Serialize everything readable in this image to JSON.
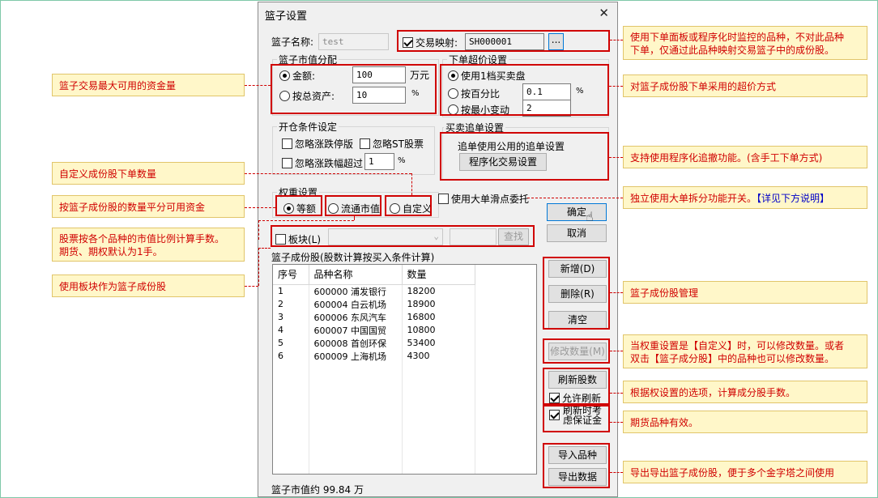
{
  "dialog": {
    "title": "篮子设置",
    "close_glyph": "✕",
    "basket_name_label": "篮子名称:",
    "basket_name_value": "test",
    "mapping": {
      "label": "交易映射:",
      "checked": true,
      "value": "SH000001",
      "browse_label": "..."
    },
    "cap_alloc": {
      "title": "篮子市值分配",
      "amount_label": "金额:",
      "amount_value": "100",
      "amount_unit": "万元",
      "total_asset_label": "按总资产:",
      "total_asset_value": "10",
      "total_asset_unit": "%"
    },
    "over_price": {
      "title": "下单超价设置",
      "opt1": "使用1档买卖盘",
      "opt2_label": "按百分比",
      "opt2_value": "0.1",
      "opt2_unit": "%",
      "opt3_label": "按最小变动",
      "opt3_value": "2"
    },
    "open_cond": {
      "title": "开仓条件设定",
      "ignore_limit": "忽略涨跌停版",
      "ignore_st": "忽略ST股票",
      "ignore_range": "忽略涨跌幅超过",
      "range_value": "1",
      "range_unit": "%"
    },
    "chase": {
      "title": "买卖追单设置",
      "text": "追单使用公用的追单设置",
      "button": "程序化交易设置"
    },
    "weight": {
      "title": "权重设置",
      "opt1": "等额",
      "opt2": "流通市值",
      "opt3": "自定义"
    },
    "big_order_label": "使用大单滑点委托",
    "ok_label": "确定",
    "cancel_label": "取消",
    "sector": {
      "label": "板块(L)",
      "find_label": "查找"
    },
    "components": {
      "title": "篮子成份股(股数计算按买入条件计算)",
      "columns": [
        "序号",
        "品种名称",
        "数量"
      ],
      "rows": [
        {
          "no": "1",
          "name": "600000 浦发银行",
          "qty": "18200"
        },
        {
          "no": "2",
          "name": "600004 白云机场",
          "qty": "18900"
        },
        {
          "no": "3",
          "name": "600006 东风汽车",
          "qty": "16800"
        },
        {
          "no": "4",
          "name": "600007 中国国贸",
          "qty": "10800"
        },
        {
          "no": "5",
          "name": "600008 首创环保",
          "qty": "53400"
        },
        {
          "no": "6",
          "name": "600009 上海机场",
          "qty": "4300"
        }
      ]
    },
    "add_label": "新增(D)",
    "delete_label": "删除(R)",
    "clear_label": "清空",
    "modify_qty_label": "修改数量(M)",
    "refresh_label": "刷新股数",
    "allow_refresh_label": "允许刷新",
    "margin_label_line1": "刷新时考",
    "margin_label_line2": "虑保证金",
    "import_label": "导入品种",
    "export_label": "导出数据",
    "footer": "篮子市值约 99.84 万"
  },
  "annotations": {
    "left": [
      "篮子交易最大可用的资金量",
      "自定义成份股下单数量",
      "按篮子成份股的数量平分可用资金",
      "股票按各个品种的市值比例计算手数。",
      "期货、期权默认为1手。",
      "使用板块作为篮子成份股"
    ],
    "right": {
      "mapping_line1": "使用下单面板或程序化时监控的品种，不对此品种",
      "mapping_line2": "下单，仅通过此品种映射交易篮子中的成份股。",
      "over_price": "对篮子成份股下单采用的超价方式",
      "chase": "支持使用程序化追撤功能。(含手工下单方式)",
      "big_order": "独立使用大单拆分功能开关。",
      "big_order_link": "【详见下方说明】",
      "component_mgmt": "篮子成份股管理",
      "modify_line1": "当权重设置是【自定义】时，可以修改数量。或者",
      "modify_line2": "双击【篮子成分股】中的品种也可以修改数量。",
      "refresh": "根据权设置的选项，计算成分股手数。",
      "margin": "期货品种有效。",
      "import_export": "导出导出篮子成份股，便于多个金字塔之间使用"
    }
  },
  "colors": {
    "annotation_text": "#d00000",
    "annotation_bg": "#fff7c9",
    "highlight_border": "#d00000",
    "link_blue": "#0000c8",
    "dialog_bg": "#f0f0f0"
  }
}
